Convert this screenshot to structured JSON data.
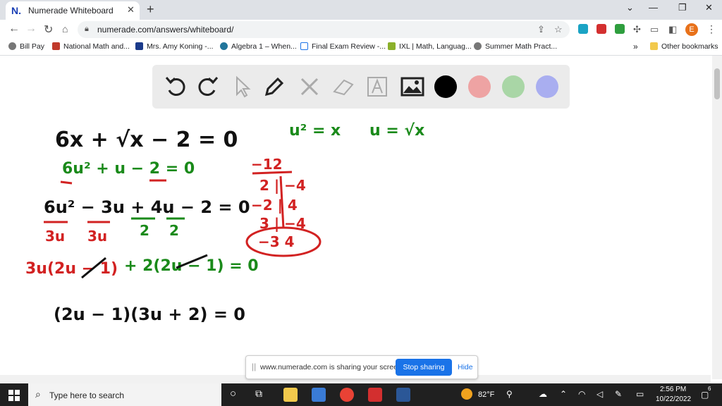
{
  "browser": {
    "tab_title": "Numerade Whiteboard",
    "tab_favicon": "N.",
    "url": "numerade.com/answers/whiteboard/",
    "profile_initial": "E",
    "bookmarks": [
      {
        "label": "Bill Pay",
        "icon": "globe-icon",
        "color": "#555555"
      },
      {
        "label": "National Math and...",
        "icon": "numerade-icon",
        "color": "#c0392b"
      },
      {
        "label": "Mrs. Amy Koning -...",
        "icon": "classroom-icon",
        "color": "#1a3a8a"
      },
      {
        "label": "Algebra 1 – When...",
        "icon": "wordpress-icon",
        "color": "#21759b"
      },
      {
        "label": "Final Exam Review -...",
        "icon": "doc-icon",
        "color": "#1a73e8"
      },
      {
        "label": "IXL | Math, Languag...",
        "icon": "ixl-icon",
        "color": "#8bb02a"
      },
      {
        "label": "Summer Math Pract...",
        "icon": "globe-icon",
        "color": "#555555"
      }
    ],
    "bookmarks_overflow": "»",
    "other_bookmarks": "Other bookmarks"
  },
  "whiteboard": {
    "tools": [
      "undo-icon",
      "redo-icon",
      "pointer-icon",
      "pen-icon",
      "tools-icon",
      "eraser-icon",
      "text-icon",
      "image-icon"
    ],
    "colors": [
      "#000000",
      "#eea3a3",
      "#a9d6a6",
      "#a9aef0"
    ],
    "lines": [
      {
        "text": "6x + √x − 2 = 0",
        "color": "#111111"
      },
      {
        "text": "u² = x",
        "color": "#1a8a1a"
      },
      {
        "text": "u = √x",
        "color": "#1a8a1a"
      },
      {
        "text": "6u² + u − 2 = 0",
        "color": "#1a8a1a"
      },
      {
        "text": "−12",
        "color": "#d22222"
      },
      {
        "text": "2 | −4",
        "color": "#d22222"
      },
      {
        "text": "−2 | 4",
        "color": "#d22222"
      },
      {
        "text": "3 | −4",
        "color": "#d22222"
      },
      {
        "text": "−3   4",
        "color": "#d22222"
      },
      {
        "text": "6u² − 3u + 4u − 2 = 0",
        "color": "#111111"
      },
      {
        "text": "3u",
        "color": "#d22222"
      },
      {
        "text": "3u",
        "color": "#d22222"
      },
      {
        "text": "2",
        "color": "#1a8a1a"
      },
      {
        "text": "2",
        "color": "#1a8a1a"
      },
      {
        "text": "3u(2u − 1)",
        "color": "#d22222"
      },
      {
        "text": "+ 2(2u − 1) = 0",
        "color": "#1a8a1a"
      },
      {
        "text": "(2u − 1)(3u + 2) = 0",
        "color": "#111111"
      }
    ]
  },
  "share_bar": {
    "grip": "||",
    "message": "www.numerade.com is sharing your screen.",
    "stop_label": "Stop sharing",
    "hide_label": "Hide"
  },
  "taskbar": {
    "search_placeholder": "Type here to search",
    "weather": "82°F",
    "time": "2:56 PM",
    "date": "10/22/2022",
    "notification_count": "6"
  }
}
